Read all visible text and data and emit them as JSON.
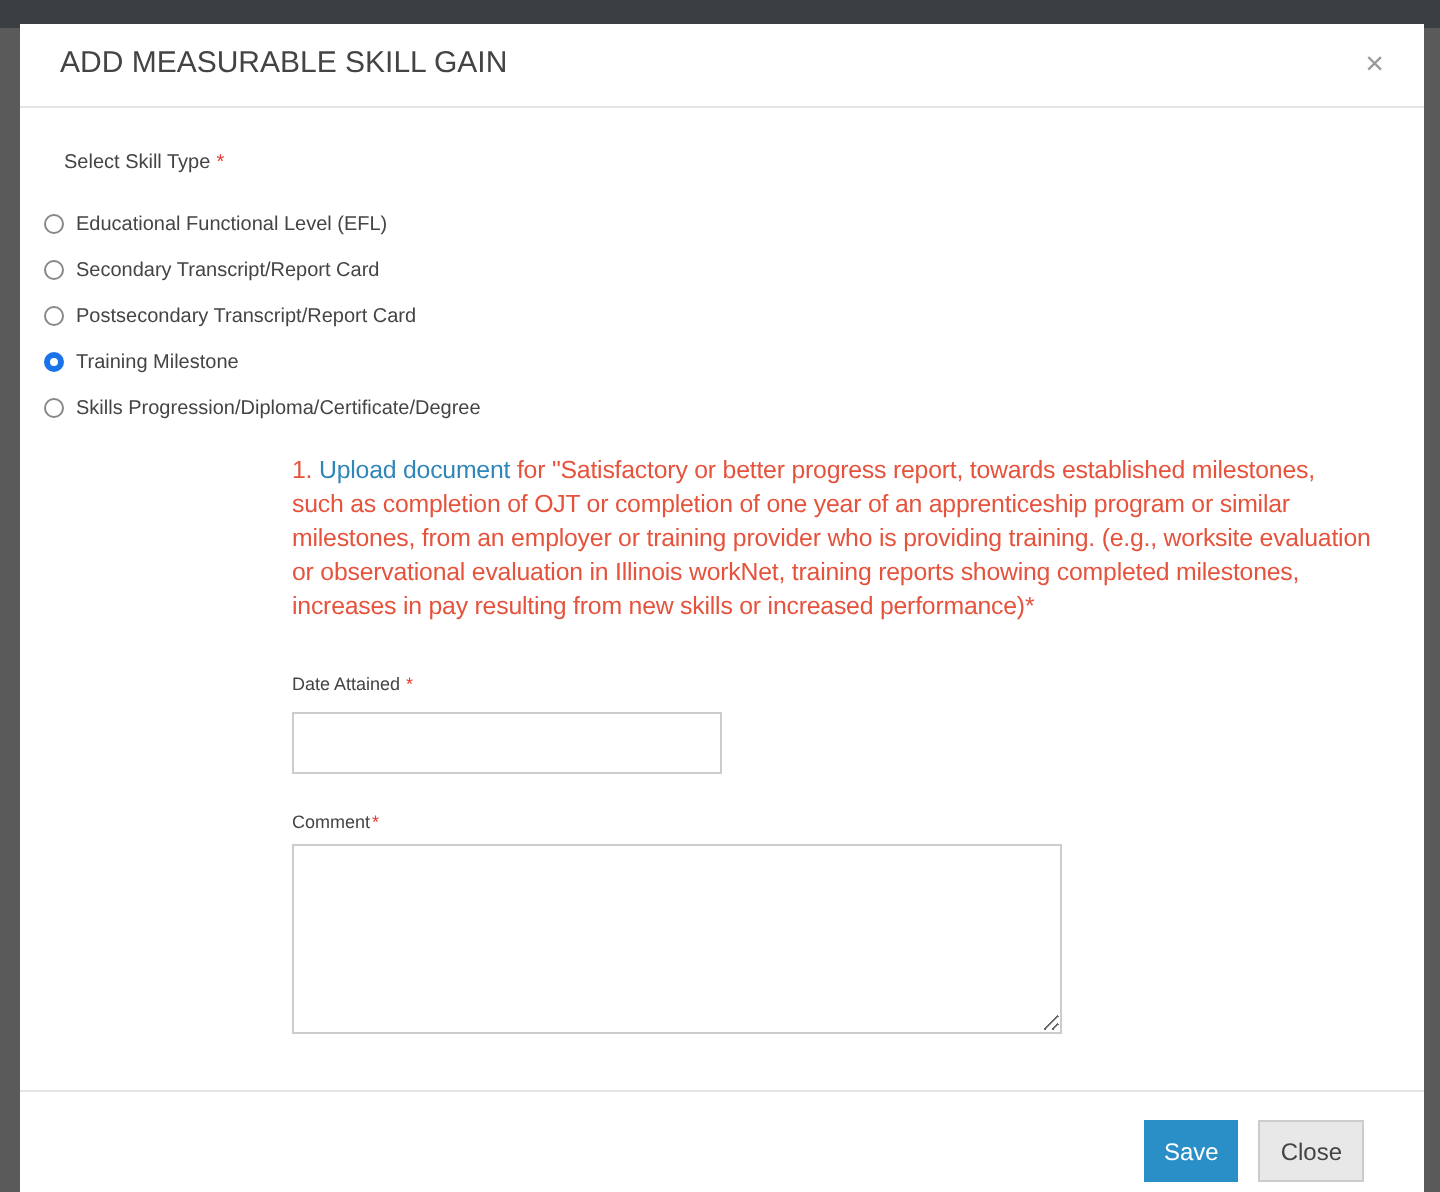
{
  "modal": {
    "title": "ADD MEASURABLE SKILL GAIN",
    "close_icon": "×"
  },
  "skill_type": {
    "label": "Select Skill Type",
    "required": "*",
    "options": [
      {
        "label": "Educational Functional Level (EFL)",
        "selected": false
      },
      {
        "label": "Secondary Transcript/Report Card",
        "selected": false
      },
      {
        "label": "Postsecondary Transcript/Report Card",
        "selected": false
      },
      {
        "label": "Training Milestone",
        "selected": true
      },
      {
        "label": "Skills Progression/Diploma/Certificate/Degree",
        "selected": false
      }
    ]
  },
  "instruction": {
    "number": "1.",
    "link": "Upload document",
    "text": "for \"Satisfactory or better progress report, towards established milestones, such as completion of OJT or completion of one year of an apprenticeship program or similar milestones, from an employer or training provider who is providing training. (e.g., worksite evaluation or observational evaluation in Illinois workNet, training reports showing completed milestones, increases in pay resulting from new skills or increased performance)*"
  },
  "date_attained": {
    "label": "Date Attained",
    "required": "*"
  },
  "comment": {
    "label": "Comment",
    "required": "*"
  },
  "buttons": [
    {
      "label": "Save",
      "kind": "primary"
    },
    {
      "label": "Close",
      "kind": "secondary"
    }
  ]
}
